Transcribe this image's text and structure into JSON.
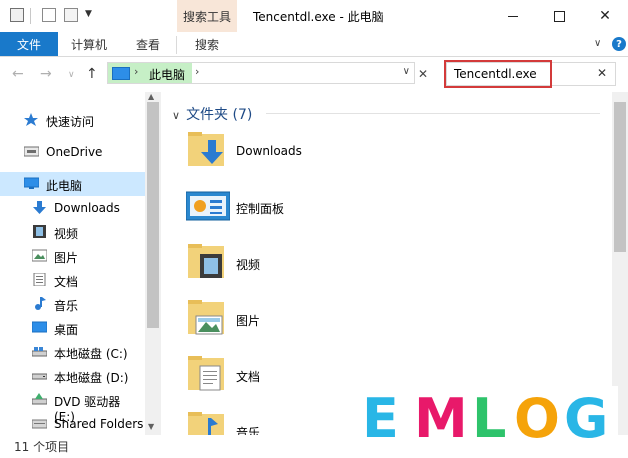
{
  "title_bar": {
    "context_tab": "搜索工具",
    "window_title": "Tencentdl.exe - 此电脑"
  },
  "ribbon": {
    "tabs": [
      "文件",
      "计算机",
      "查看",
      "搜索"
    ]
  },
  "address": {
    "path_label": "此电脑"
  },
  "search": {
    "value": "Tencentdl.exe"
  },
  "nav_pane": {
    "items": [
      {
        "label": "快速访问",
        "icon": "star-pin-icon"
      },
      {
        "label": "OneDrive",
        "icon": "cloud-icon"
      },
      {
        "label": "此电脑",
        "icon": "computer-icon"
      },
      {
        "label": "Downloads",
        "icon": "download-arrow-icon"
      },
      {
        "label": "视频",
        "icon": "video-icon"
      },
      {
        "label": "图片",
        "icon": "picture-icon"
      },
      {
        "label": "文档",
        "icon": "document-icon"
      },
      {
        "label": "音乐",
        "icon": "music-note-icon"
      },
      {
        "label": "桌面",
        "icon": "desktop-icon"
      },
      {
        "label": "本地磁盘 (C:)",
        "icon": "drive-icon"
      },
      {
        "label": "本地磁盘 (D:)",
        "icon": "drive-icon"
      },
      {
        "label": "DVD 驱动器 (E:)",
        "icon": "dvd-drive-icon"
      },
      {
        "label": "Shared Folders",
        "icon": "shared-folder-icon"
      }
    ]
  },
  "content": {
    "group_title": "文件夹 (7)",
    "folders": [
      {
        "label": "Downloads",
        "icon": "downloads-folder-icon"
      },
      {
        "label": "控制面板",
        "icon": "control-panel-icon"
      },
      {
        "label": "视频",
        "icon": "videos-folder-icon"
      },
      {
        "label": "图片",
        "icon": "pictures-folder-icon"
      },
      {
        "label": "文档",
        "icon": "documents-folder-icon"
      },
      {
        "label": "音乐",
        "icon": "music-folder-icon"
      }
    ]
  },
  "status": {
    "item_count": "11 个项目"
  },
  "watermark": {
    "letters": [
      "E",
      "M",
      "L",
      "O",
      "G"
    ],
    "colors": [
      "#29b6e6",
      "#e8196a",
      "#2ec36b",
      "#f5a30a",
      "#29b6e6"
    ]
  }
}
